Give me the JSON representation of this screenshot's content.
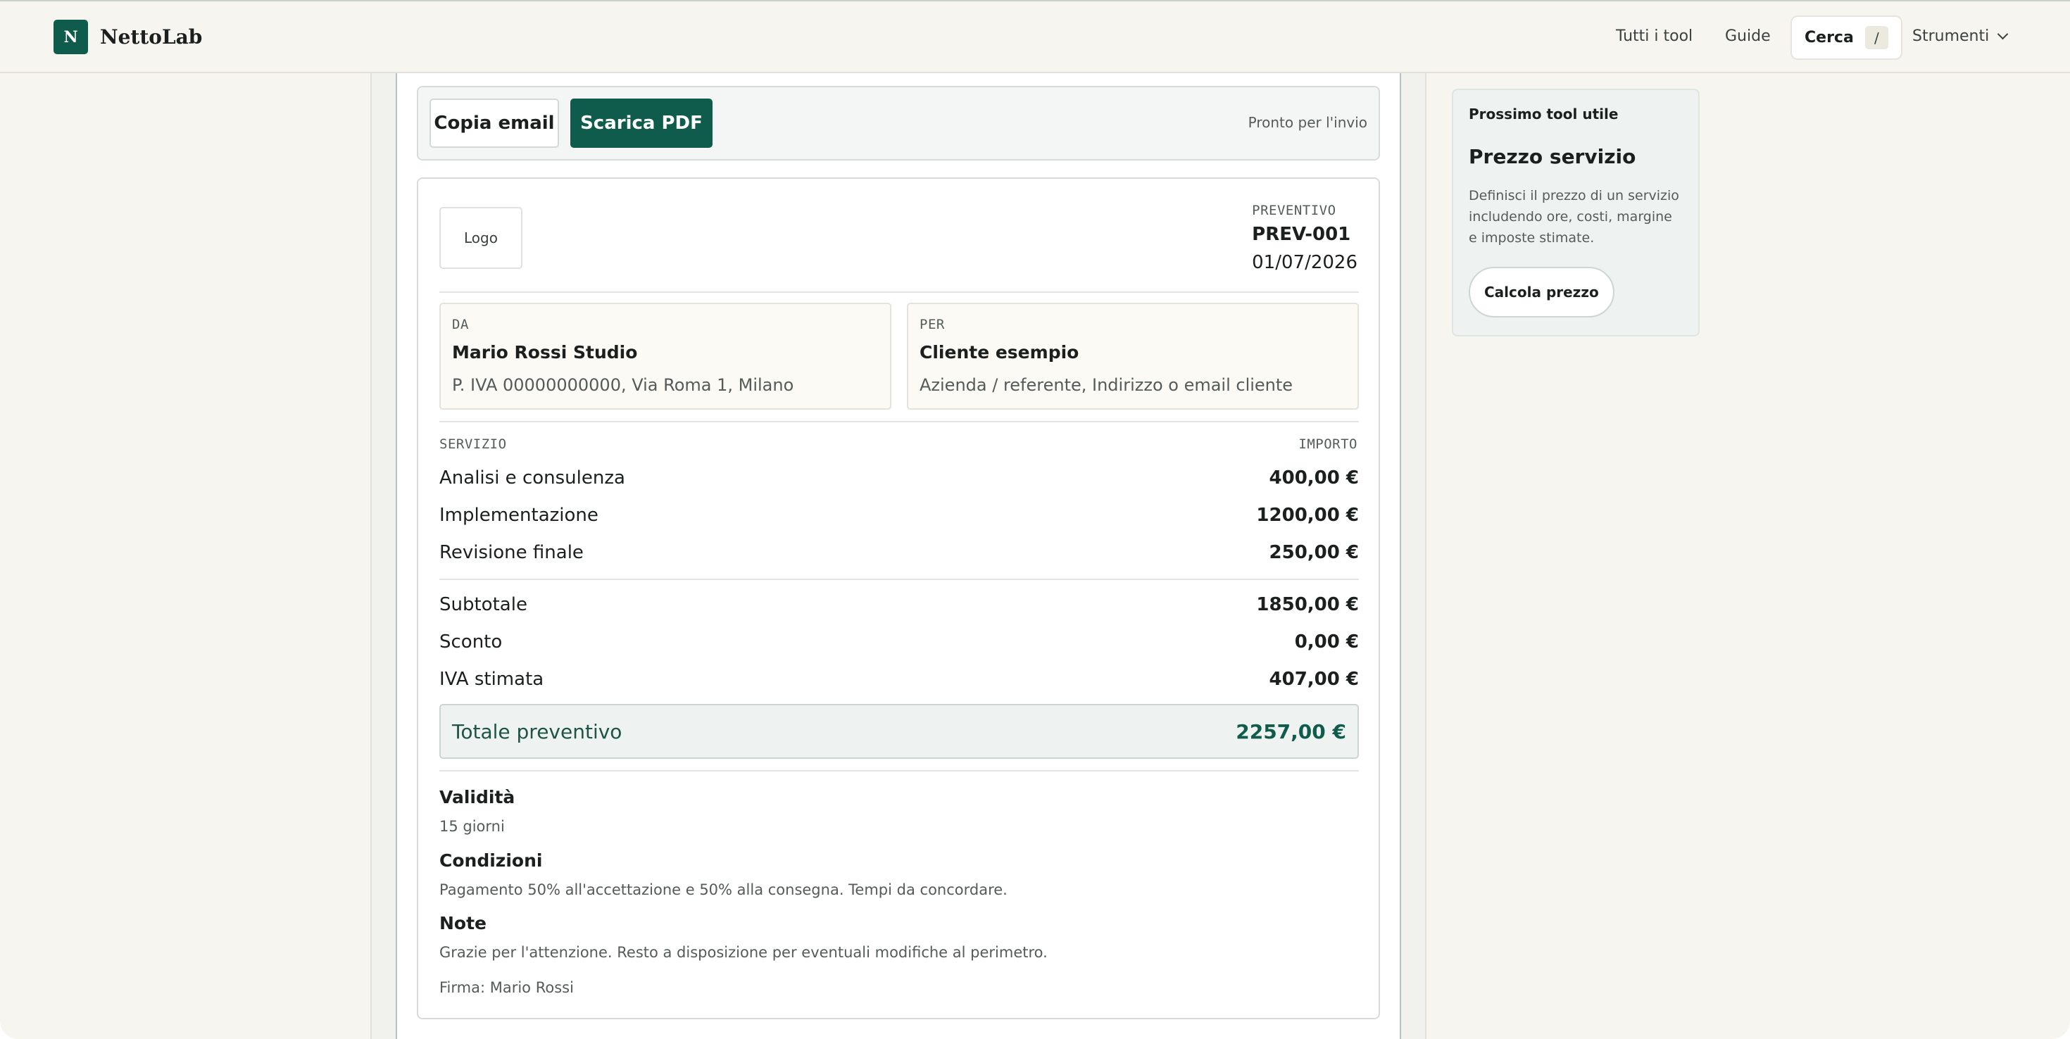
{
  "brand": {
    "mark": "N",
    "name": "NettoLab"
  },
  "nav": {
    "all_tools": "Tutti i tool",
    "guides": "Guide",
    "search_label": "Cerca",
    "search_shortcut": "/",
    "tools_menu": "Strumenti"
  },
  "actions": {
    "copy_email": "Copia email",
    "download_pdf": "Scarica PDF",
    "status": "Pronto per l'invio"
  },
  "quote": {
    "logo_placeholder": "Logo",
    "kind_label": "PREVENTIVO",
    "number": "PREV-001",
    "date": "01/07/2026",
    "from": {
      "label": "DA",
      "name": "Mario Rossi Studio",
      "info": "P. IVA 00000000000, Via Roma 1, Milano"
    },
    "to": {
      "label": "PER",
      "name": "Cliente esempio",
      "info": "Azienda / referente, Indirizzo o email cliente"
    },
    "columns": {
      "service": "SERVIZIO",
      "amount": "IMPORTO"
    },
    "items": [
      {
        "name": "Analisi e consulenza",
        "amount": "400,00 €"
      },
      {
        "name": "Implementazione",
        "amount": "1200,00 €"
      },
      {
        "name": "Revisione finale",
        "amount": "250,00 €"
      }
    ],
    "summary": [
      {
        "label": "Subtotale",
        "value": "1850,00 €"
      },
      {
        "label": "Sconto",
        "value": "0,00 €"
      },
      {
        "label": "IVA stimata",
        "value": "407,00 €"
      }
    ],
    "total": {
      "label": "Totale preventivo",
      "value": "2257,00 €"
    },
    "validity": {
      "heading": "Validità",
      "text": "15 giorni"
    },
    "conditions": {
      "heading": "Condizioni",
      "text": "Pagamento 50% all'accettazione e 50% alla consegna. Tempi da concordare."
    },
    "notes": {
      "heading": "Note",
      "text": "Grazie per l'attenzione. Resto a disposizione per eventuali modifiche al perimetro."
    },
    "signature": "Firma: Mario Rossi"
  },
  "side_card": {
    "kicker": "Prossimo tool utile",
    "title": "Prezzo servizio",
    "description": "Definisci il prezzo di un servizio includendo ore, costi, margine e imposte stimate.",
    "button": "Calcola prezzo"
  },
  "colors": {
    "brand": "#0f5b4c",
    "page_bg": "#f7f5ef",
    "total_bg": "#eef3f1"
  }
}
